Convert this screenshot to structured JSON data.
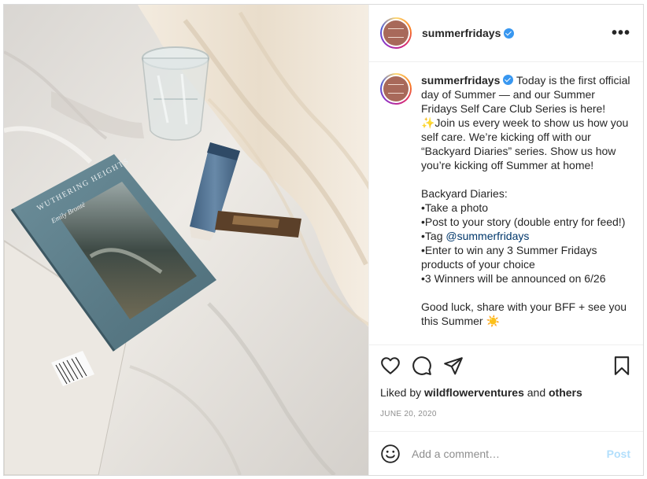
{
  "post": {
    "username": "summerfridays",
    "verified": true,
    "more_icon": "more-horizontal-icon",
    "image_alt": "Photo of a Wuthering Heights book, a glass of water and Summer Fridays products on a white bedsheet",
    "book": {
      "title": "WUTHERING HEIGHTS",
      "author": "Emily Brontë"
    },
    "caption": {
      "username": "summerfridays",
      "part1": " Today is the first official day of Summer — and our Summer Fridays Self Care Club Series is here!✨Join us every week to show us how you self care. We’re kicking off with our “Backyard Diaries” series. Show us how you’re kicking off Summer at home!\n\nBackyard Diaries:\n•Take a photo\n•Post to your story (double entry for feed!)\n•Tag ",
      "mention": "@summerfridays",
      "part2": "\n•Enter to win any 3 Summer Fridays products of your choice\n•3 Winners will be announced on 6/26\n\nGood luck, share with your BFF + see you this Summer ☀️"
    },
    "actions": {
      "like_icon": "heart-icon",
      "comment_icon": "comment-icon",
      "share_icon": "paper-plane-icon",
      "save_icon": "bookmark-icon"
    },
    "likes": {
      "prefix": "Liked by ",
      "user": "wildflowerventures",
      "middle": " and ",
      "others": "others"
    },
    "date": "JUNE 20, 2020",
    "comment": {
      "emoji_icon": "smiley-icon",
      "placeholder": "Add a comment…",
      "post_label": "Post"
    },
    "colors": {
      "verified": "#3897f0",
      "post_button_disabled": "#b2dffc",
      "mention": "#00376b",
      "meta_text": "#8e8e8e"
    }
  }
}
